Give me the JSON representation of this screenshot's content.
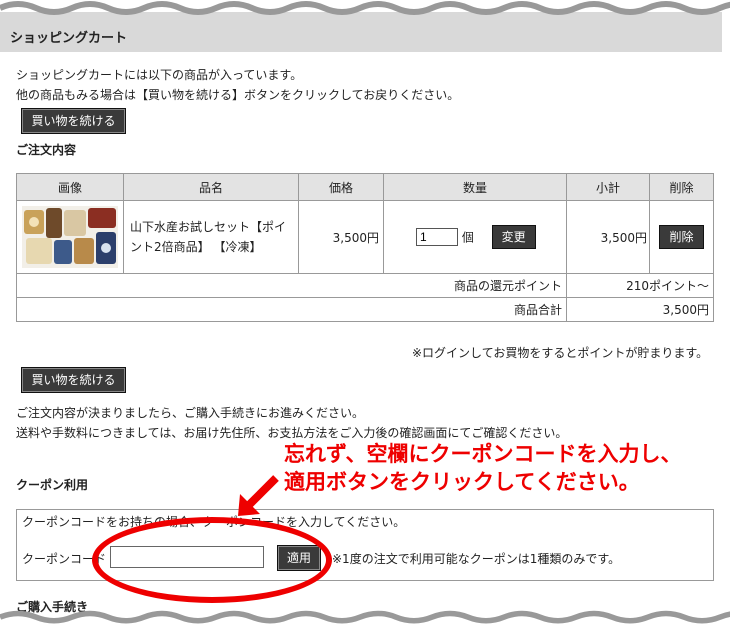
{
  "header": {
    "title": "ショッピングカート"
  },
  "intro": {
    "line1": "ショッピングカートには以下の商品が入っています。",
    "line2": "他の商品もみる場合は【買い物を続ける】ボタンをクリックしてお戻りください。"
  },
  "buttons": {
    "continue_shopping": "買い物を続ける",
    "change": "変更",
    "delete": "削除",
    "apply": "適用"
  },
  "order_heading": "ご注文内容",
  "table": {
    "headers": [
      "画像",
      "品名",
      "価格",
      "数量",
      "小計",
      "削除"
    ],
    "item": {
      "name_line1": "山下水産お試しセット【ポイ",
      "name_line2": "ント2倍商品】 【冷凍】",
      "price": "3,500円",
      "quantity": "1",
      "unit": "個",
      "subtotal": "3,500円"
    },
    "points_label": "商品の還元ポイント",
    "points_value": "210ポイント～",
    "total_label": "商品合計",
    "total_value": "3,500円"
  },
  "login_note": "※ログインしてお買物をするとポイントが貯まります。",
  "proceed": {
    "line1": "ご注文内容が決まりましたら、ご購入手続きにお進みください。",
    "line2": "送料や手数料につきましては、お届け先住所、お支払方法をご入力後の確認画面にてご確認ください。"
  },
  "coupon": {
    "heading": "クーポン利用",
    "description": "クーポンコードをお持ちの場合、クーポンコードを入力してください。",
    "label": "クーポンコード",
    "value": "",
    "note": "※1度の注文で利用可能なクーポンは1種類のみです。"
  },
  "annotation": {
    "line1": "忘れず、空欄にクーポンコードを入力し、",
    "line2": "適用ボタンをクリックしてください。",
    "color": "#e00000"
  },
  "purchase_heading": "ご購入手続き"
}
